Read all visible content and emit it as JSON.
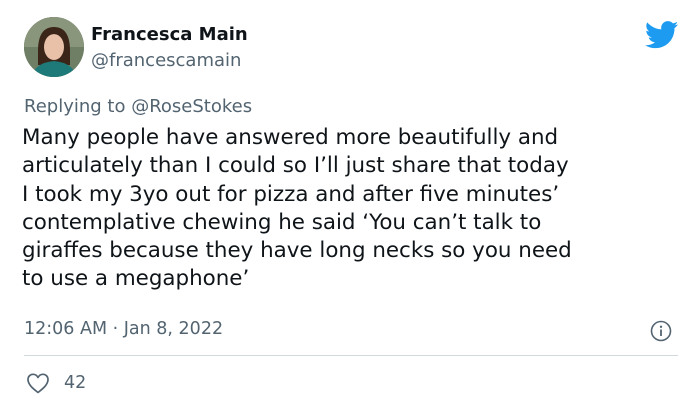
{
  "author": {
    "name": "Francesca Main",
    "handle": "@francescamain"
  },
  "reply_context": {
    "prefix": "Replying to ",
    "mention": "@RoseStokes"
  },
  "tweet": {
    "lines": [
      "Many people have answered more beautifully and",
      "articulately than I could so I’ll just share that today",
      "I took my 3yo out for pizza and after five minutes’",
      "contemplative chewing he said ‘You can’t talk to",
      "giraffes because they have long necks so you need",
      "to use a megaphone’"
    ],
    "timestamp": "12:06 AM · Jan 8, 2022"
  },
  "stats": {
    "likes": "42"
  },
  "icons": {
    "brand": "twitter-bird-icon",
    "info": "info-icon",
    "like": "heart-icon"
  },
  "colors": {
    "brand_blue": "#1d9bf0",
    "secondary_text": "#536471",
    "primary_text": "#0f1419",
    "divider": "#cfd9de"
  }
}
